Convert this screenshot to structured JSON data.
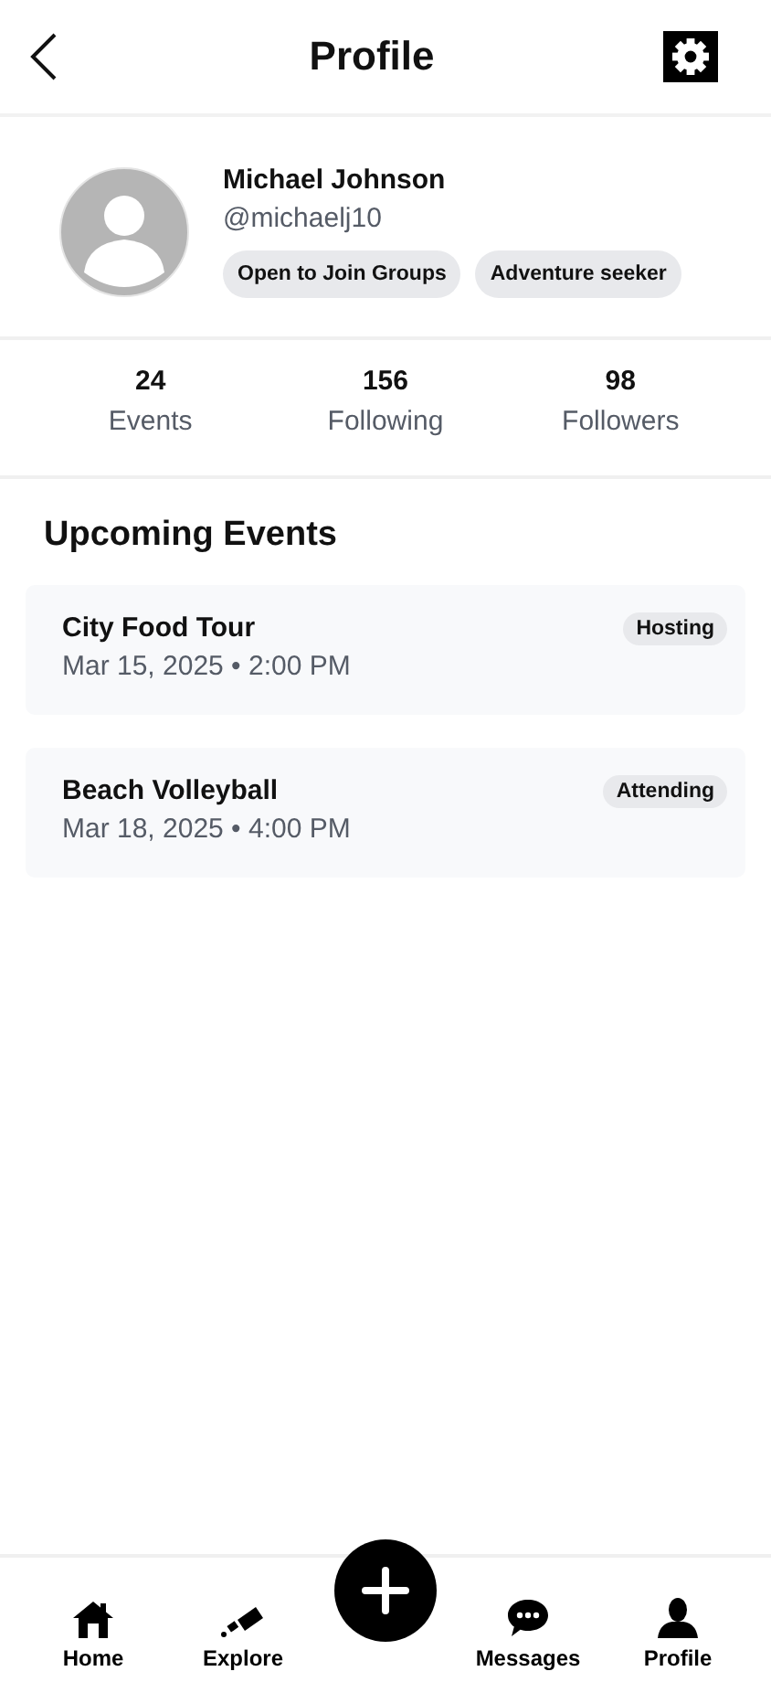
{
  "header": {
    "title": "Profile"
  },
  "profile": {
    "name": "Michael Johnson",
    "handle": "@michaelj10",
    "tags": [
      "Open to Join Groups",
      "Adventure seeker"
    ]
  },
  "stats": [
    {
      "value": "24",
      "label": "Events"
    },
    {
      "value": "156",
      "label": "Following"
    },
    {
      "value": "98",
      "label": "Followers"
    }
  ],
  "upcoming": {
    "title": "Upcoming Events",
    "events": [
      {
        "name": "City Food Tour",
        "when": "Mar 15, 2025 • 2:00 PM",
        "role": "Hosting"
      },
      {
        "name": "Beach Volleyball",
        "when": "Mar 18, 2025 • 4:00 PM",
        "role": "Attending"
      }
    ]
  },
  "nav": [
    {
      "kind": "home",
      "label": "Home"
    },
    {
      "kind": "explore",
      "label": "Explore"
    },
    {
      "kind": "add"
    },
    {
      "kind": "messages",
      "label": "Messages"
    },
    {
      "kind": "profile",
      "label": "Profile"
    }
  ]
}
